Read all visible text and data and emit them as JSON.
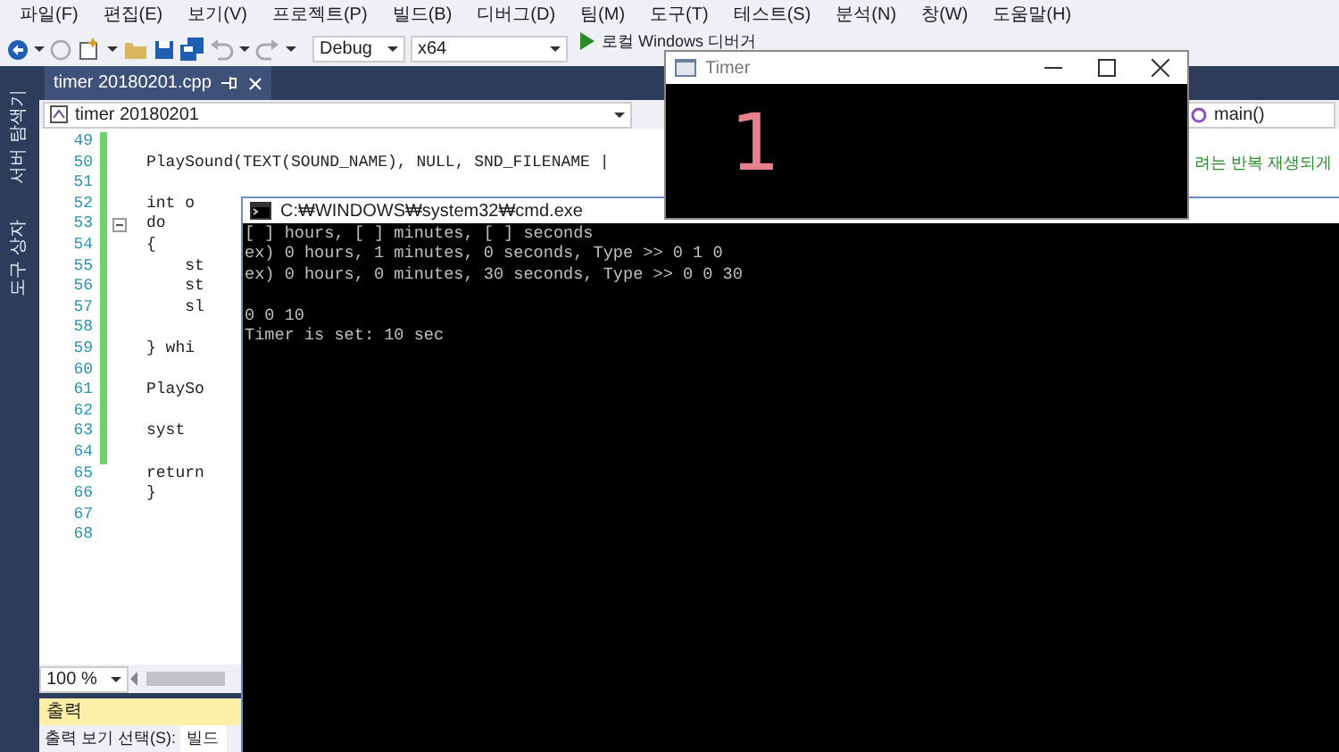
{
  "menu": [
    {
      "label": "파일(F)"
    },
    {
      "label": "편집(E)"
    },
    {
      "label": "보기(V)"
    },
    {
      "label": "프로젝트(P)"
    },
    {
      "label": "빌드(B)"
    },
    {
      "label": "디버그(D)"
    },
    {
      "label": "팀(M)"
    },
    {
      "label": "도구(T)"
    },
    {
      "label": "테스트(S)"
    },
    {
      "label": "분석(N)"
    },
    {
      "label": "창(W)"
    },
    {
      "label": "도움말(H)"
    }
  ],
  "toolbar": {
    "configuration": "Debug",
    "platform": "x64",
    "run_label": "로컬 Windows 디버거"
  },
  "side_tabs": [
    "서버 탐색기",
    "도구 상자"
  ],
  "document_tab": {
    "title": "timer 20180201.cpp"
  },
  "navigation": {
    "project": "timer 20180201",
    "member": "main()"
  },
  "editor": {
    "comment": "려는 반복 재생되게",
    "lines": [
      {
        "number": "49",
        "changed": true,
        "fold": false
      },
      {
        "number": "50",
        "code": "PlaySound(TEXT(SOUND_NAME), NULL, SND_FILENAME |",
        "changed": true,
        "fold": false
      },
      {
        "number": "51",
        "changed": true,
        "fold": false
      },
      {
        "number": "52",
        "code": "int o",
        "changed": true,
        "fold": false
      },
      {
        "number": "53",
        "code": "do",
        "changed": true,
        "fold": true
      },
      {
        "number": "54",
        "code": "{",
        "changed": true,
        "fold": false
      },
      {
        "number": "55",
        "code": "    st",
        "changed": true,
        "fold": false
      },
      {
        "number": "56",
        "code": "    st",
        "changed": true,
        "fold": false
      },
      {
        "number": "57",
        "code": "    sl",
        "changed": true,
        "fold": false
      },
      {
        "number": "58",
        "changed": true,
        "fold": false
      },
      {
        "number": "59",
        "code": "} whi",
        "changed": true,
        "fold": false
      },
      {
        "number": "60",
        "changed": true,
        "fold": false
      },
      {
        "number": "61",
        "code": "PlaySo",
        "changed": true,
        "fold": false
      },
      {
        "number": "62",
        "changed": true,
        "fold": false
      },
      {
        "number": "63",
        "code": "syst",
        "changed": true,
        "fold": false
      },
      {
        "number": "64",
        "changed": true,
        "fold": false
      },
      {
        "number": "65",
        "code": "return",
        "changed": false,
        "fold": false
      },
      {
        "number": "66",
        "code": "}",
        "changed": false,
        "fold": false
      },
      {
        "number": "67",
        "changed": false,
        "fold": false
      },
      {
        "number": "68",
        "changed": false,
        "fold": false
      }
    ]
  },
  "zoom": "100 %",
  "output": {
    "title": "출력",
    "source_label": "출력 보기 선택(S):",
    "source": "빌드"
  },
  "console": {
    "title": "C:₩WINDOWS₩system32₩cmd.exe",
    "lines": [
      {
        "kind": "text",
        "text": "[ ] hours, [ ] minutes, [ ] seconds"
      },
      {
        "kind": "text",
        "text": "ex) 0 hours, 1 minutes, 0 seconds, Type >> 0 1 0"
      },
      {
        "kind": "text",
        "text": "ex) 0 hours, 0 minutes, 30 seconds, Type >> 0 0 30"
      },
      {
        "kind": "blank"
      },
      {
        "kind": "text",
        "text": "0 0 10"
      },
      {
        "kind": "text",
        "text": "Timer is set: 10 sec"
      }
    ]
  },
  "timer": {
    "title": "Timer",
    "display": "1"
  }
}
